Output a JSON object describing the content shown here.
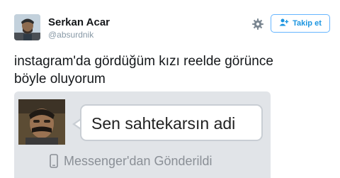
{
  "user": {
    "name": "Serkan Acar",
    "handle": "@absurdnik"
  },
  "actions": {
    "settings_icon": "gear-icon",
    "follow_icon": "add-user-icon",
    "follow_label": "Takip et"
  },
  "tweet": {
    "text_line1": "instagram'da gördüğüm kızı reelde görünce",
    "text_line2": "böyle oluyorum"
  },
  "media": {
    "message_text": "Sen sahtekarsın adi",
    "sent_via_icon": "phone-icon",
    "sent_via": "Messenger'dan Gönderildi"
  },
  "colors": {
    "accent": "#1b95e0",
    "muted": "#8899a6",
    "text": "#14171a"
  }
}
